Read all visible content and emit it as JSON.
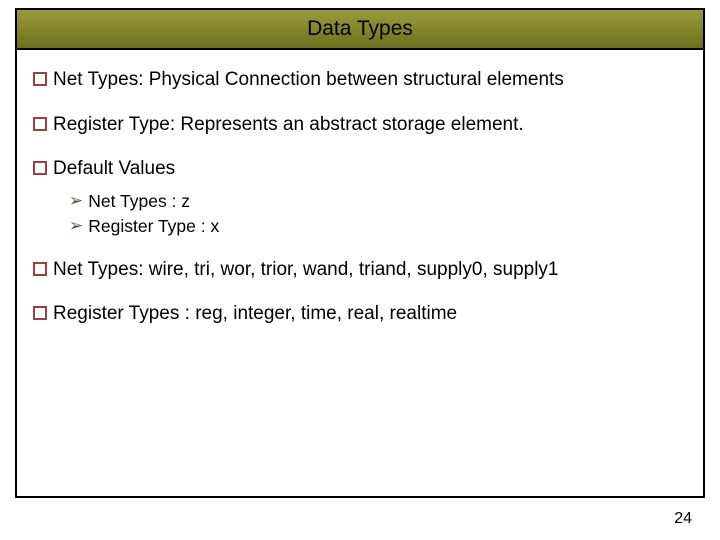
{
  "slide": {
    "title": "Data Types",
    "bullets": [
      {
        "text": "Net Types: Physical Connection between structural elements"
      },
      {
        "text": "Register Type: Represents an abstract storage element."
      },
      {
        "text": "Default Values"
      },
      {
        "text": "Net Types: wire, tri, wor, trior, wand, triand, supply0, supply1"
      },
      {
        "text": "Register Types : reg, integer, time, real, realtime"
      }
    ],
    "sub_bullets": [
      {
        "text": "Net Types : z"
      },
      {
        "text": "Register Type : x"
      }
    ],
    "page_number": "24"
  }
}
